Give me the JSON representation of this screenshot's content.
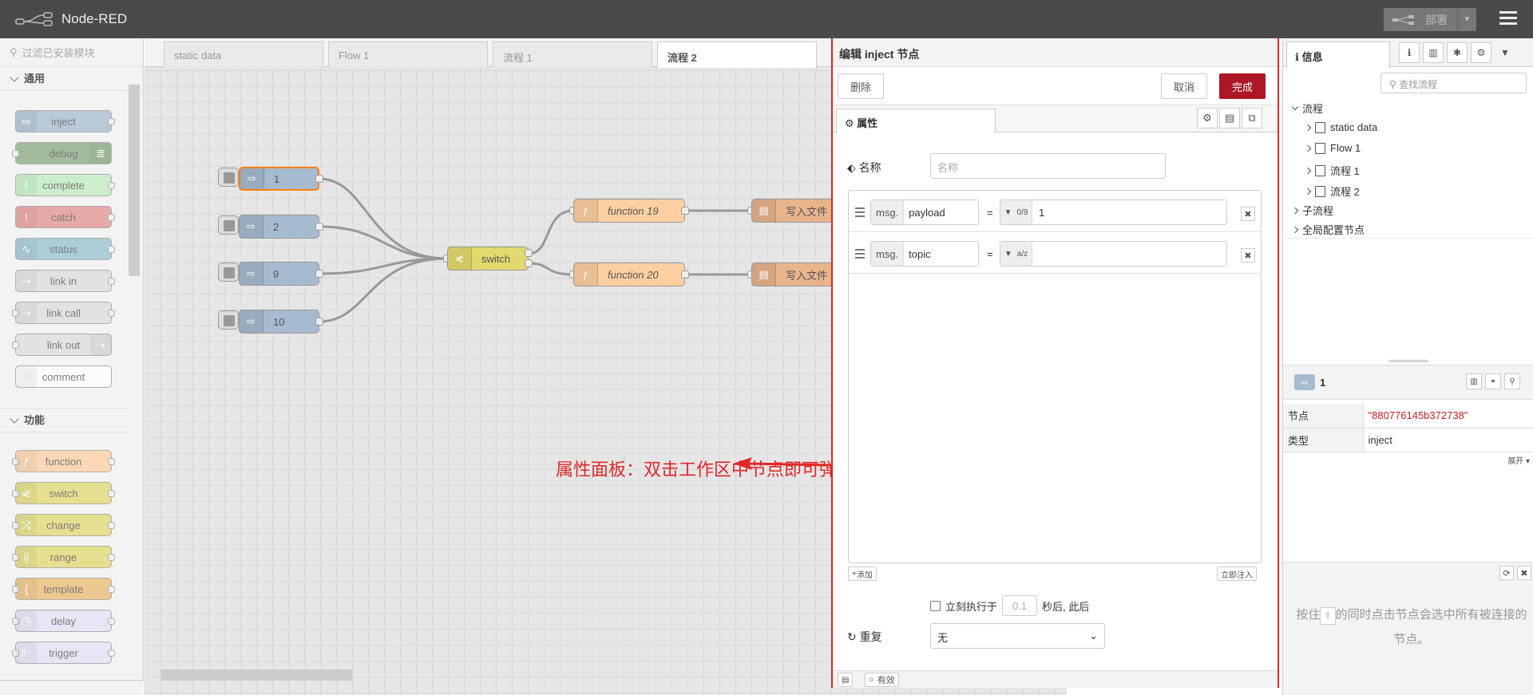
{
  "app": {
    "title": "Node-RED",
    "deploy_label": "部署"
  },
  "palette": {
    "search_placeholder": "过滤已安装模块",
    "categories": [
      {
        "label": "通用",
        "nodes": [
          "inject",
          "debug",
          "complete",
          "catch",
          "status",
          "link in",
          "link call",
          "link out",
          "comment"
        ]
      },
      {
        "label": "功能",
        "nodes": [
          "function",
          "switch",
          "change",
          "range",
          "template",
          "delay",
          "trigger"
        ]
      }
    ]
  },
  "colors": {
    "inject": "#a6bbcf",
    "debug": "#87a980",
    "complete": "#c0edc0",
    "catch": "#e49191",
    "status": "#94c1d0",
    "link": "#dddddd",
    "comment": "#ffffff",
    "function": "#fdd0a2",
    "switch": "#e2d96e",
    "change": "#e2d96e",
    "range": "#e2d96e",
    "template": "#ebbb6f",
    "delay": "#e6e0f8",
    "trigger": "#e6e0f8",
    "accent": "#ad1625",
    "annotation": "#e02828"
  },
  "workspace": {
    "tabs": [
      "static data",
      "Flow 1",
      "流程 1",
      "流程 2"
    ],
    "active_tab": "流程 2",
    "nodes": {
      "inject_1": "1",
      "inject_2": "2",
      "inject_9": "9",
      "inject_10": "10",
      "switch": "switch",
      "function_19": "function 19",
      "function_20": "function 20",
      "file_1": "写入文件",
      "file_2": "写入文件"
    },
    "annotation": "属性面板：双击工作区中节点即可弹出"
  },
  "editor": {
    "title": "编辑 inject 节点",
    "delete_label": "删除",
    "cancel_label": "取消",
    "done_label": "完成",
    "properties_tab": "属性",
    "name_label": "名称",
    "name_placeholder": "名称",
    "props": [
      {
        "prefix": "msg.",
        "key": "payload",
        "type_icon": "0/9",
        "value": "1"
      },
      {
        "prefix": "msg.",
        "key": "topic",
        "type_icon": "a/z",
        "value": ""
      }
    ],
    "add_label": "添加",
    "inject_now_label": "立即注入",
    "once_label": "立刻执行于",
    "once_delay": "0.1",
    "once_suffix": "秒后, 此后",
    "repeat_label": "重复",
    "repeat_value": "无",
    "enabled_label": "有效"
  },
  "sidebar": {
    "info_tab": "信息",
    "search_placeholder": "查找流程",
    "tree": {
      "flows_label": "流程",
      "flows": [
        "static data",
        "Flow 1",
        "流程 1",
        "流程 2"
      ],
      "subflows_label": "子流程",
      "config_label": "全局配置节点"
    },
    "selected_node": {
      "label": "1",
      "node_key": "节点",
      "node_id": "\"880776145b372738\"",
      "type_key": "类型",
      "type_value": "inject",
      "expand_label": "展开"
    },
    "tip_prefix": "按住",
    "tip_key": "⇧",
    "tip_text": "的同时点击节点会选中所有被连接的节点。"
  }
}
